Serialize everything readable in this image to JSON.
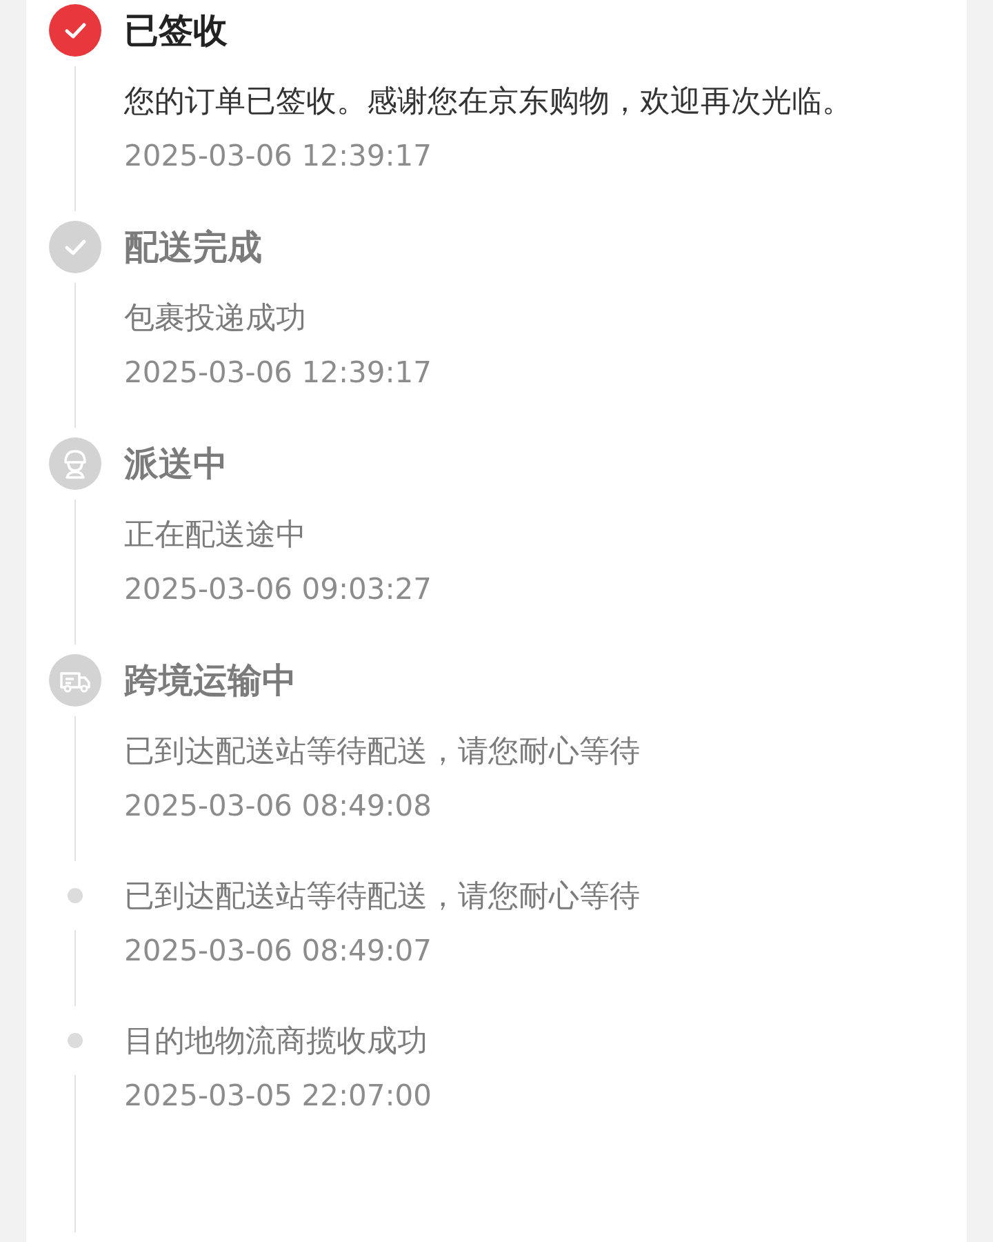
{
  "timeline": [
    {
      "kind": "check",
      "active": true,
      "title": "已签收",
      "description": "您的订单已签收。感谢您在京东购物，欢迎再次光临。",
      "time": "2025-03-06 12:39:17"
    },
    {
      "kind": "check",
      "active": false,
      "title": "配送完成",
      "description": "包裹投递成功",
      "time": "2025-03-06 12:39:17"
    },
    {
      "kind": "courier",
      "active": false,
      "title": "派送中",
      "description": "正在配送途中",
      "time": "2025-03-06 09:03:27"
    },
    {
      "kind": "truck",
      "active": false,
      "title": "跨境运输中",
      "description": "已到达配送站等待配送，请您耐心等待",
      "time": "2025-03-06 08:49:08"
    },
    {
      "kind": "dot",
      "active": false,
      "description": "已到达配送站等待配送，请您耐心等待",
      "time": "2025-03-06 08:49:07"
    },
    {
      "kind": "dot",
      "active": false,
      "description": "目的地物流商揽收成功",
      "time": "2025-03-05 22:07:00"
    }
  ]
}
